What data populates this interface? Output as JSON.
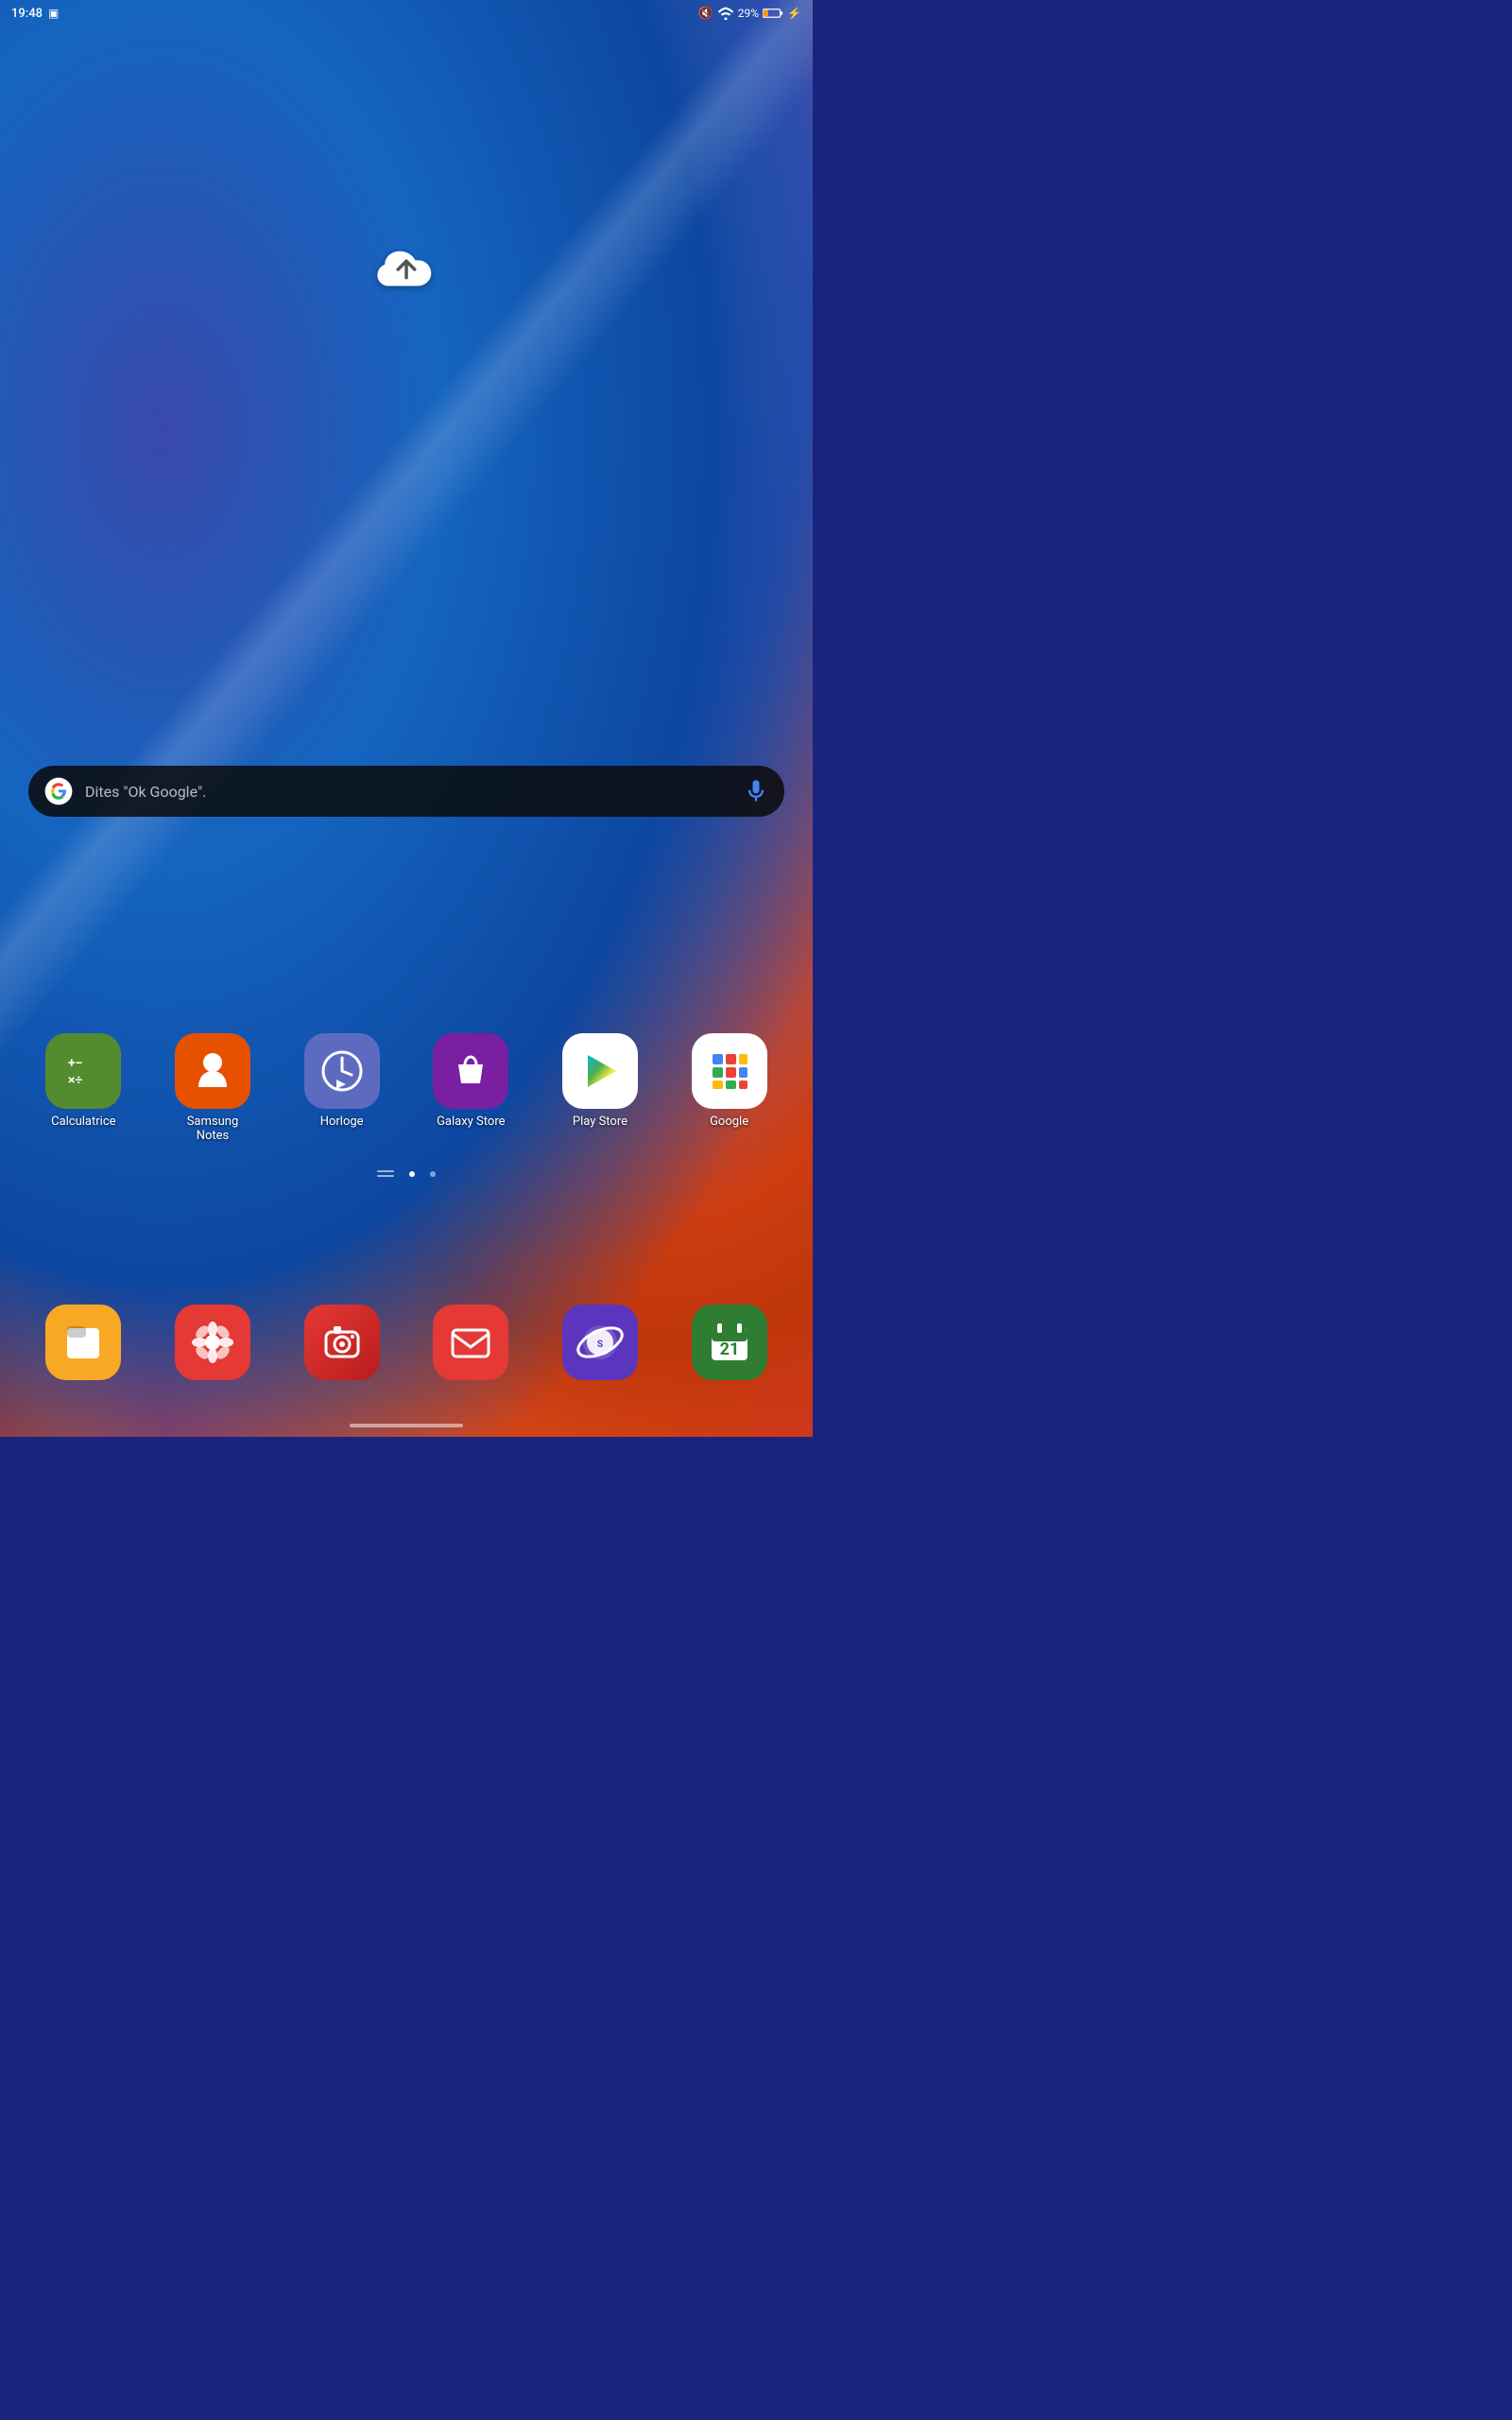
{
  "statusBar": {
    "time": "19:48",
    "battery": "29%",
    "icons": [
      "notification-screenshot",
      "mute",
      "wifi",
      "battery"
    ]
  },
  "searchBar": {
    "hint": "Dites \"Ok Google\".",
    "googleIcon": "G",
    "micIcon": "mic"
  },
  "cloudButton": {
    "label": "upload-cloud"
  },
  "navDots": {
    "count": 3,
    "active": 1
  },
  "appRow1": [
    {
      "id": "calculatrice",
      "label": "Calculatrice",
      "bg": "#558b2f"
    },
    {
      "id": "samsung-notes",
      "label": "Samsung\nNotes",
      "bg": "#e65100"
    },
    {
      "id": "horloge",
      "label": "Horloge",
      "bg": "#5c6bc0"
    },
    {
      "id": "galaxy-store",
      "label": "Galaxy Store",
      "bg": "#7b1fa2"
    },
    {
      "id": "play-store",
      "label": "Play Store",
      "bg": "#ffffff"
    },
    {
      "id": "google",
      "label": "Google",
      "bg": "#ffffff"
    }
  ],
  "appRow2": [
    {
      "id": "files",
      "label": "",
      "bg": "#f9a825"
    },
    {
      "id": "bixby",
      "label": "",
      "bg": "#e53935"
    },
    {
      "id": "camera",
      "label": "",
      "bg": "#cc0000"
    },
    {
      "id": "email",
      "label": "",
      "bg": "#e53935"
    },
    {
      "id": "internet",
      "label": "",
      "bg": "#5c35be"
    },
    {
      "id": "calendar",
      "label": "",
      "bg": "#2e7d32"
    }
  ]
}
